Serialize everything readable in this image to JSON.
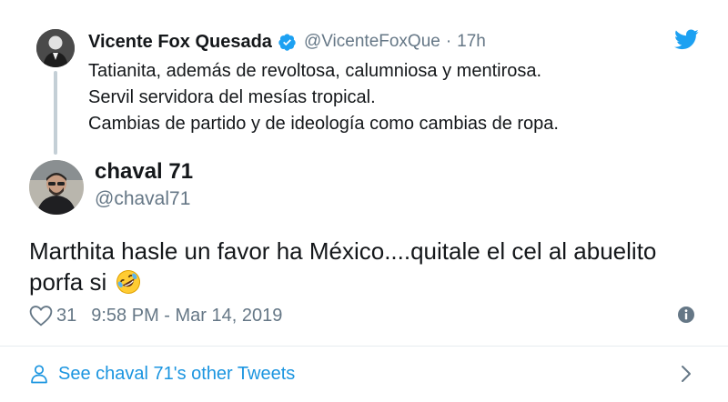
{
  "parent_tweet": {
    "author_name": "Vicente Fox Quesada",
    "handle": "@VicenteFoxQue",
    "separator": "·",
    "time_ago": "17h",
    "verified": true,
    "lines": [
      "Tatianita, además de revoltosa, calumniosa y mentirosa.",
      "Servil servidora del mesías tropical.",
      "Cambias de partido y de ideología como cambias de ropa."
    ]
  },
  "reply": {
    "author_name": "chaval 71",
    "handle": "@chaval71",
    "text_line1": "Marthita hasle un favor ha México....quitale el cel al abuelito",
    "text_line2": "porfa si",
    "emoji": "rolling-on-floor-laughing-emoji"
  },
  "meta": {
    "like_count": "31",
    "timestamp": "9:58 PM - Mar 14, 2019"
  },
  "footer": {
    "link_label": "See chaval 71's other Tweets"
  },
  "icons": {
    "brand": "twitter-bird-icon",
    "verified": "verified-badge-icon",
    "like": "heart-icon",
    "info": "info-icon",
    "profile": "person-icon",
    "next": "chevron-right-icon"
  },
  "colors": {
    "brand_blue": "#1da1f2",
    "link_blue": "#1b95e0",
    "text_primary": "#14171a",
    "text_secondary": "#657786",
    "thread_line": "#c4cfd6",
    "divider": "#e6ecf0"
  }
}
